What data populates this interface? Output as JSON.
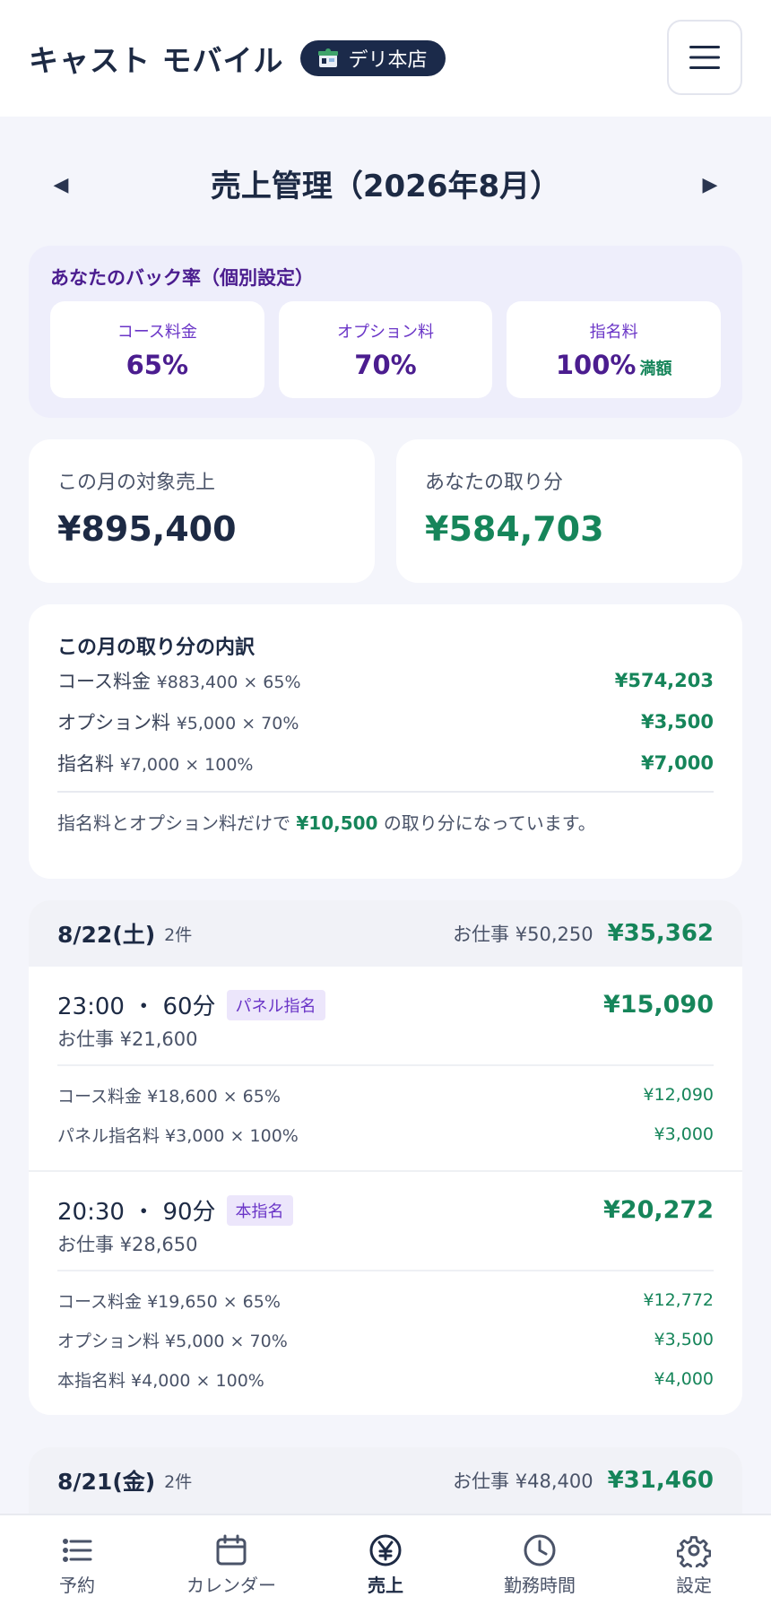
{
  "header": {
    "app_title": "キャスト モバイル",
    "store_name": "デリ本店"
  },
  "month_nav": {
    "prev_symbol": "◀",
    "next_symbol": "▶",
    "title": "売上管理（2026年8月）"
  },
  "rates": {
    "title": "あなたのバック率（個別設定）",
    "items": [
      {
        "label": "コース料金",
        "value": "65%",
        "note": ""
      },
      {
        "label": "オプション料",
        "value": "70%",
        "note": ""
      },
      {
        "label": "指名料",
        "value": "100%",
        "note": "満額"
      }
    ]
  },
  "summary": {
    "sales_label": "この月の対象売上",
    "sales_value": "¥895,400",
    "take_label": "あなたの取り分",
    "take_value": "¥584,703"
  },
  "breakdown": {
    "title": "この月の取り分の内訳",
    "rows": [
      {
        "name": "コース料金",
        "calc": "¥883,400 × 65%",
        "amount": "¥574,203"
      },
      {
        "name": "オプション料",
        "calc": "¥5,000 × 70%",
        "amount": "¥3,500"
      },
      {
        "name": "指名料",
        "calc": "¥7,000 × 100%",
        "amount": "¥7,000"
      }
    ],
    "note_prefix": "指名料とオプション料だけで",
    "note_amount": "¥10,500",
    "note_suffix": "の取り分になっています。"
  },
  "days": [
    {
      "date": "8/22(土)",
      "count": "2件",
      "work": "お仕事 ¥50,250",
      "take": "¥35,362",
      "bookings": [
        {
          "time": "23:00 ・ 60分",
          "tag": "パネル指名",
          "take": "¥15,090",
          "work": "お仕事 ¥21,600",
          "rows": [
            {
              "label": "コース料金 ¥18,600 × 65%",
              "amount": "¥12,090"
            },
            {
              "label": "パネル指名料 ¥3,000 × 100%",
              "amount": "¥3,000"
            }
          ]
        },
        {
          "time": "20:30 ・ 90分",
          "tag": "本指名",
          "take": "¥20,272",
          "work": "お仕事 ¥28,650",
          "rows": [
            {
              "label": "コース料金 ¥19,650 × 65%",
              "amount": "¥12,772"
            },
            {
              "label": "オプション料 ¥5,000 × 70%",
              "amount": "¥3,500"
            },
            {
              "label": "本指名料 ¥4,000 × 100%",
              "amount": "¥4,000"
            }
          ]
        }
      ]
    },
    {
      "date": "8/21(金)",
      "count": "2件",
      "work": "お仕事 ¥48,400",
      "take": "¥31,460",
      "bookings": []
    }
  ],
  "bottom_nav": [
    {
      "label": "予約",
      "icon": "list-icon",
      "active": false
    },
    {
      "label": "カレンダー",
      "icon": "calendar-icon",
      "active": false
    },
    {
      "label": "売上",
      "icon": "yen-icon",
      "active": true
    },
    {
      "label": "勤務時間",
      "icon": "clock-icon",
      "active": false
    },
    {
      "label": "設定",
      "icon": "gear-icon",
      "active": false
    }
  ],
  "colors": {
    "accent_green": "#16855a",
    "accent_purple": "#4b1d8f",
    "navy": "#1d2a44"
  }
}
